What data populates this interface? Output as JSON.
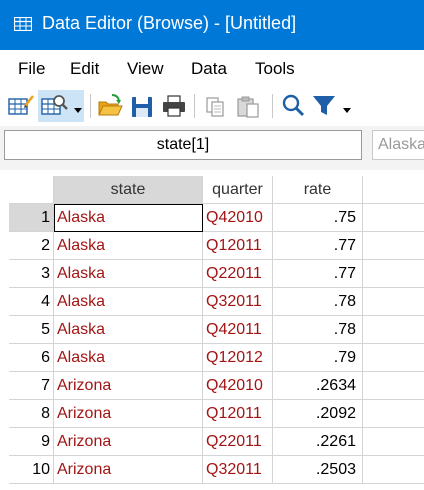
{
  "window": {
    "title": "Data Editor (Browse) - [Untitled]"
  },
  "menu": [
    "File",
    "Edit",
    "View",
    "Data",
    "Tools"
  ],
  "formula": {
    "varname": "state[1]",
    "value": "Alaska"
  },
  "columns": [
    "state",
    "quarter",
    "rate"
  ],
  "rows": [
    {
      "n": "1",
      "state": "Alaska",
      "quarter": "Q42010",
      "rate": ".75"
    },
    {
      "n": "2",
      "state": "Alaska",
      "quarter": "Q12011",
      "rate": ".77"
    },
    {
      "n": "3",
      "state": "Alaska",
      "quarter": "Q22011",
      "rate": ".77"
    },
    {
      "n": "4",
      "state": "Alaska",
      "quarter": "Q32011",
      "rate": ".78"
    },
    {
      "n": "5",
      "state": "Alaska",
      "quarter": "Q42011",
      "rate": ".78"
    },
    {
      "n": "6",
      "state": "Alaska",
      "quarter": "Q12012",
      "rate": ".79"
    },
    {
      "n": "7",
      "state": "Arizona",
      "quarter": "Q42010",
      "rate": ".2634"
    },
    {
      "n": "8",
      "state": "Arizona",
      "quarter": "Q12011",
      "rate": ".2092"
    },
    {
      "n": "9",
      "state": "Arizona",
      "quarter": "Q22011",
      "rate": ".2261"
    },
    {
      "n": "10",
      "state": "Arizona",
      "quarter": "Q32011",
      "rate": ".2503"
    }
  ],
  "colors": {
    "titlebar": "#0078d7",
    "string_value": "#a31515",
    "icon_blue": "#1e5fa8",
    "folder": "#e8a317"
  },
  "icons": [
    "data-editor-edit-icon",
    "data-editor-browse-icon",
    "open-icon",
    "save-icon",
    "print-icon",
    "copy-icon",
    "paste-icon",
    "find-icon",
    "filter-icon"
  ]
}
